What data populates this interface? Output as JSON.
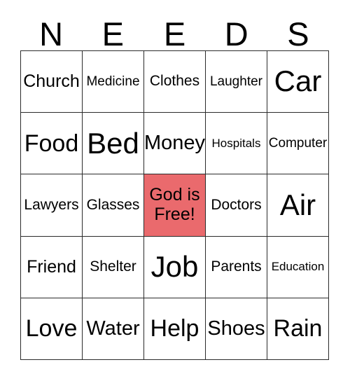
{
  "card": {
    "header_letters": [
      "N",
      "E",
      "E",
      "D",
      "S"
    ],
    "free_space_color": "#ea6a6d",
    "border_color": "#2b2b2b",
    "background_color": "#ffffff",
    "text_color": "#000000",
    "rows": [
      [
        {
          "label": "Church",
          "free": false
        },
        {
          "label": "Medicine",
          "free": false
        },
        {
          "label": "Clothes",
          "free": false
        },
        {
          "label": "Laughter",
          "free": false
        },
        {
          "label": "Car",
          "free": false
        }
      ],
      [
        {
          "label": "Food",
          "free": false
        },
        {
          "label": "Bed",
          "free": false
        },
        {
          "label": "Money",
          "free": false
        },
        {
          "label": "Hospitals",
          "free": false
        },
        {
          "label": "Computer",
          "free": false
        }
      ],
      [
        {
          "label": "Lawyers",
          "free": false
        },
        {
          "label": "Glasses",
          "free": false
        },
        {
          "label": "God is Free!",
          "free": true
        },
        {
          "label": "Doctors",
          "free": false
        },
        {
          "label": "Air",
          "free": false
        }
      ],
      [
        {
          "label": "Friend",
          "free": false
        },
        {
          "label": "Shelter",
          "free": false
        },
        {
          "label": "Job",
          "free": false
        },
        {
          "label": "Parents",
          "free": false
        },
        {
          "label": "Education",
          "free": false
        }
      ],
      [
        {
          "label": "Love",
          "free": false
        },
        {
          "label": "Water",
          "free": false
        },
        {
          "label": "Help",
          "free": false
        },
        {
          "label": "Shoes",
          "free": false
        },
        {
          "label": "Rain",
          "free": false
        }
      ]
    ]
  }
}
